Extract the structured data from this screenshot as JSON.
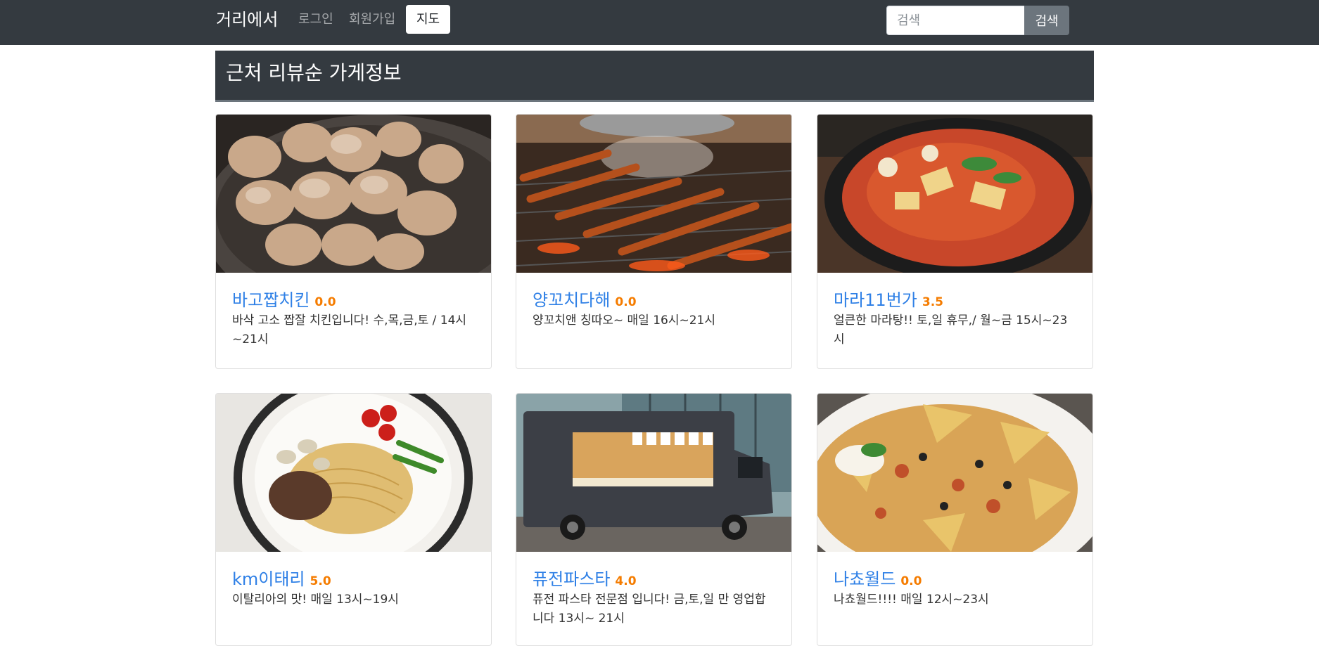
{
  "nav": {
    "brand": "거리에서",
    "login": "로그인",
    "signup": "회원가입",
    "map": "지도",
    "search_placeholder": "검색",
    "search_button": "검색"
  },
  "section": {
    "title": "근처 리뷰순 가게정보"
  },
  "stores": [
    {
      "name": "바고짭치킨",
      "rating": "0.0",
      "desc": "바삭 고소 짭잘 치킨입니다! 수,목,금,토 / 14시~21시",
      "image": "fried-chicken-photo"
    },
    {
      "name": "양꼬치다해",
      "rating": "0.0",
      "desc": "양꼬치앤 칭따오~ 매일 16시~21시",
      "image": "lamb-skewers-photo"
    },
    {
      "name": "마라11번가",
      "rating": "3.5",
      "desc": "얼큰한 마라탕!! 토,일 휴무,/ 월~금 15시~23시",
      "image": "malatang-photo"
    },
    {
      "name": "km이태리",
      "rating": "5.0",
      "desc": "이탈리아의 맛! 매일 13시~19시",
      "image": "spaghetti-photo"
    },
    {
      "name": "퓨전파스타",
      "rating": "4.0",
      "desc": "퓨전 파스타 전문점 입니다! 금,토,일 만 영업합니다 13시~ 21시",
      "image": "food-truck-photo"
    },
    {
      "name": "나쵸월드",
      "rating": "0.0",
      "desc": "나쵸월드!!!! 매일 12시~23시",
      "image": "nachos-photo"
    }
  ],
  "colors": {
    "navbar": "#343a40",
    "link": "#2f80e6",
    "rating": "#f57c00"
  }
}
